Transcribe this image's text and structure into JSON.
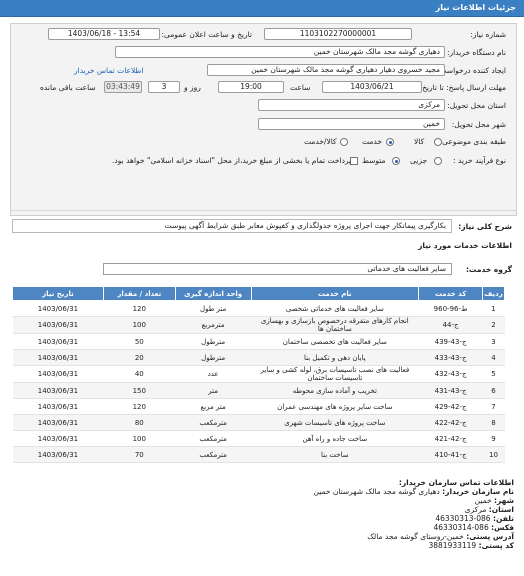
{
  "header": {
    "title": "جزئیات اطلاعات نیاز"
  },
  "form": {
    "need_number_label": "شماره نیاز:",
    "need_number": "1103102270000001",
    "announce_label": "تاریخ و ساعت اعلان عمومی:",
    "announce_value": "1403/06/18 - 13:54",
    "buyer_label": "نام دستگاه خریدار:",
    "buyer_value": "دهیاری گوشه مجد مالک شهرستان خمین",
    "creator_label": "ایجاد کننده درخواست:",
    "creator_value": "مجید خسروی دهیار دهیاری گوشه مجد مالک شهرستان خمین",
    "buyer_contact_link": "اطلاعات تماس خریدار",
    "deadline_label": "مهلت ارسال پاسخ: تا تاریخ:",
    "deadline_date": "1403/06/21",
    "time_label": "ساعت",
    "deadline_time": "19:00",
    "days_value": "3",
    "days_label": "روز و",
    "remaining_time": "03:43:49",
    "remaining_label": "ساعت باقی مانده",
    "province_label": "استان محل تحویل:",
    "province_value": "مرکزی",
    "city_label": "شهر محل تحویل:",
    "city_value": "خمین",
    "category_label": "طبقه بندی موضوعی:",
    "category_options": [
      "کالا",
      "خدمت",
      "کالا/خدمت"
    ],
    "category_selected": "خدمت",
    "process_label": "نوع فرآیند خرید :",
    "process_options": [
      "جزیی",
      "متوسط"
    ],
    "process_selected": "متوسط",
    "payment_note": "پرداخت تمام یا بخشی از مبلغ خرید،از محل \"اسناد خزانه اسلامی\" خواهد بود."
  },
  "description": {
    "label": "شرح کلی نیاز:",
    "value": "بکارگیری پیمانکار جهت اجرای پروژه جدولگذاری و کفپوش معابر طبق شرایط آگهی پیوست"
  },
  "services": {
    "section_title": "اطلاعات خدمات مورد نیاز",
    "group_label": "گروه خدمت:",
    "group_value": "سایر فعالیت های خدماتی",
    "columns": [
      "ردیف",
      "کد خدمت",
      "نام خدمت",
      "واحد اندازه گیری",
      "تعداد / مقدار",
      "تاریخ نیاز"
    ],
    "rows": [
      {
        "idx": "1",
        "code": "ط-96-960",
        "name": "سایر فعالیت های خدماتی شخصی",
        "unit": "متر طول",
        "qty": "120",
        "date": "1403/06/31"
      },
      {
        "idx": "2",
        "code": "ج-44",
        "name": "انجام کارهای متفرقه درخصوص بازسازی و بهسازی ساختمان ها",
        "unit": "مترمربع",
        "qty": "100",
        "date": "1403/06/31"
      },
      {
        "idx": "3",
        "code": "ج-43-439",
        "name": "سایر فعالیت های تخصصی ساختمان",
        "unit": "مترطول",
        "qty": "50",
        "date": "1403/06/31"
      },
      {
        "idx": "4",
        "code": "ج-43-433",
        "name": "پایان دهی و تکمیل بنا",
        "unit": "مترطول",
        "qty": "20",
        "date": "1403/06/31"
      },
      {
        "idx": "5",
        "code": "ج-43-432",
        "name": "فعالیت های نصب تاسیسات برق، لوله کشی و سایر تاسیسات ساختمان",
        "unit": "عدد",
        "qty": "40",
        "date": "1403/06/31"
      },
      {
        "idx": "6",
        "code": "ج-43-431",
        "name": "تخریب و آماده سازی محوطه",
        "unit": "متر",
        "qty": "150",
        "date": "1403/06/31"
      },
      {
        "idx": "7",
        "code": "ج-42-429",
        "name": "ساخت سایر پروژه های مهندسی عمران",
        "unit": "متر مربع",
        "qty": "120",
        "date": "1403/06/31"
      },
      {
        "idx": "8",
        "code": "ج-42-422",
        "name": "ساخت پروژه های تاسیسات شهری",
        "unit": "مترمکعب",
        "qty": "80",
        "date": "1403/06/31"
      },
      {
        "idx": "9",
        "code": "ج-42-421",
        "name": "ساخت جاده و راه آهن",
        "unit": "مترمکعب",
        "qty": "100",
        "date": "1403/06/31"
      },
      {
        "idx": "10",
        "code": "ج-41-410",
        "name": "ساخت بنا",
        "unit": "مترمکعب",
        "qty": "70",
        "date": "1403/06/31"
      }
    ]
  },
  "contact": {
    "title": "اطلاعات تماس سازمان خریدار:",
    "org_label": "نام سازمان خریدار:",
    "org_value": "دهیاری گوشه مجد مالک شهرستان خمین",
    "city_label": "شهر:",
    "city_value": "خمین",
    "province_label": "استان:",
    "province_value": "مرکزی",
    "phone_label": "تلفن:",
    "phone_value": "086-46330313",
    "fax_label": "فکس:",
    "fax_value": "086-46330314",
    "address_label": "آدرس پستی:",
    "address_value": "خمین-روستای گوشه مجد مالک",
    "postal_label": "کد پستی:",
    "postal_value": "3881933119"
  },
  "colors": {
    "header": "#3a7fc1",
    "table_header": "#4e86c4",
    "link": "#1f5fb5"
  }
}
